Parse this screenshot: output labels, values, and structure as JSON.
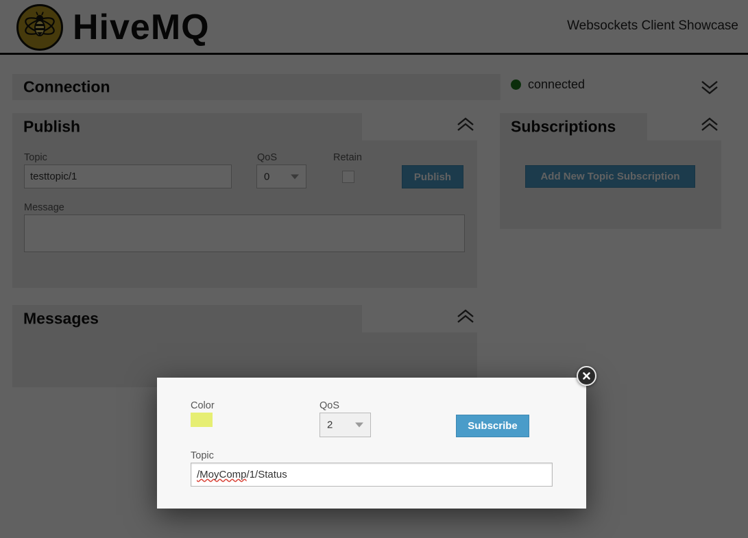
{
  "header": {
    "brand_hive": "Hive",
    "brand_mq": "MQ",
    "logo_icon": "bee-logo-icon",
    "showcase_title": "Websockets Client Showcase"
  },
  "connection": {
    "title": "Connection",
    "status_text": "connected",
    "status_color": "#1f7a1f",
    "collapse_icon": "chevron-double-down-icon"
  },
  "publish": {
    "title": "Publish",
    "collapse_icon": "chevron-double-up-icon",
    "topic_label": "Topic",
    "topic_value": "testtopic/1",
    "qos_label": "QoS",
    "qos_value": "0",
    "retain_label": "Retain",
    "retain_checked": false,
    "message_label": "Message",
    "message_value": "",
    "publish_button": "Publish"
  },
  "subscriptions": {
    "title": "Subscriptions",
    "collapse_icon": "chevron-double-up-icon",
    "add_button": "Add New Topic Subscription"
  },
  "messages": {
    "title": "Messages",
    "collapse_icon": "chevron-double-up-icon"
  },
  "modal": {
    "color_label": "Color",
    "color_value": "#e6ee73",
    "qos_label": "QoS",
    "qos_value": "2",
    "subscribe_button": "Subscribe",
    "topic_label": "Topic",
    "topic_value_misspelled": "/MoyComp",
    "topic_value_rest": "/1/Status",
    "topic_value_full": "/MoyComp/1/Status",
    "close_icon": "close-x-icon"
  },
  "theme": {
    "accent_blue": "#4a9cc9",
    "panel_grey": "#ececec",
    "brand_gold": "#b79a20"
  }
}
